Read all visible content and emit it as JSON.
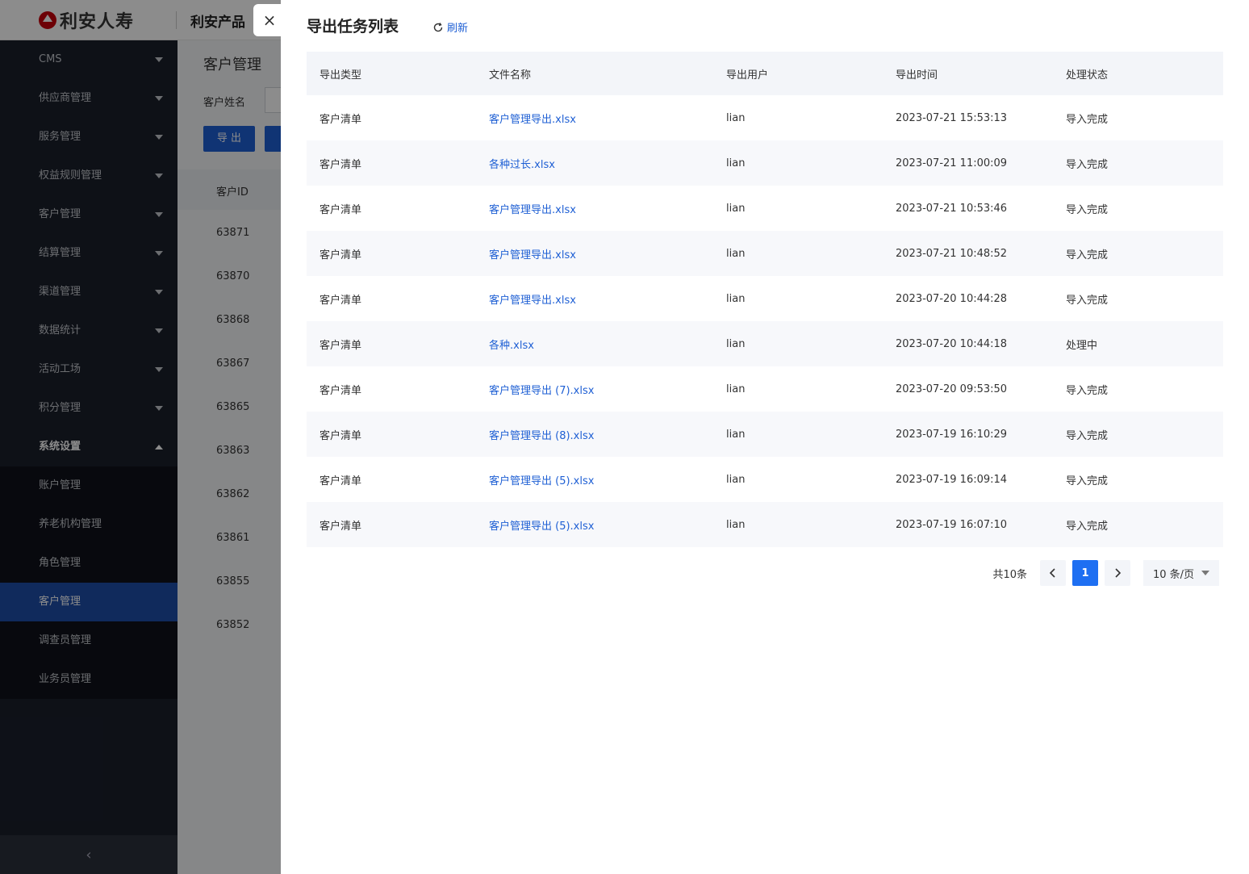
{
  "app": {
    "brand": "利安人寿",
    "product": "利安产品"
  },
  "sidebar": {
    "items": [
      {
        "label": "CMS"
      },
      {
        "label": "供应商管理"
      },
      {
        "label": "服务管理"
      },
      {
        "label": "权益规则管理"
      },
      {
        "label": "客户管理"
      },
      {
        "label": "结算管理"
      },
      {
        "label": "渠道管理"
      },
      {
        "label": "数据统计"
      },
      {
        "label": "活动工场"
      },
      {
        "label": "积分管理"
      },
      {
        "label": "系统设置"
      }
    ],
    "subitems": [
      {
        "label": "账户管理"
      },
      {
        "label": "养老机构管理"
      },
      {
        "label": "角色管理"
      },
      {
        "label": "客户管理"
      },
      {
        "label": "调查员管理"
      },
      {
        "label": "业务员管理"
      }
    ],
    "collapse": "‹"
  },
  "background_page": {
    "title": "客户管理",
    "filter_label": "客户姓名",
    "export_button": "导 出",
    "id_column": "客户ID",
    "ids": [
      "63871",
      "63870",
      "63868",
      "63867",
      "63865",
      "63863",
      "63862",
      "63861",
      "63855",
      "63852"
    ]
  },
  "drawer": {
    "close": "×",
    "title": "导出任务列表",
    "refresh_label": "刷新",
    "columns": [
      "导出类型",
      "文件名称",
      "导出用户",
      "导出时间",
      "处理状态"
    ],
    "rows": [
      {
        "type": "客户清单",
        "file": "客户管理导出.xlsx",
        "user": "lian",
        "time": "2023-07-21 15:53:13",
        "status": "导入完成"
      },
      {
        "type": "客户清单",
        "file": "各种过长.xlsx",
        "user": "lian",
        "time": "2023-07-21 11:00:09",
        "status": "导入完成"
      },
      {
        "type": "客户清单",
        "file": "客户管理导出.xlsx",
        "user": "lian",
        "time": "2023-07-21 10:53:46",
        "status": "导入完成"
      },
      {
        "type": "客户清单",
        "file": "客户管理导出.xlsx",
        "user": "lian",
        "time": "2023-07-21 10:48:52",
        "status": "导入完成"
      },
      {
        "type": "客户清单",
        "file": "客户管理导出.xlsx",
        "user": "lian",
        "time": "2023-07-20 10:44:28",
        "status": "导入完成"
      },
      {
        "type": "客户清单",
        "file": "各种.xlsx",
        "user": "lian",
        "time": "2023-07-20 10:44:18",
        "status": "处理中"
      },
      {
        "type": "客户清单",
        "file": "客户管理导出 (7).xlsx",
        "user": "lian",
        "time": "2023-07-20 09:53:50",
        "status": "导入完成"
      },
      {
        "type": "客户清单",
        "file": "客户管理导出 (8).xlsx",
        "user": "lian",
        "time": "2023-07-19 16:10:29",
        "status": "导入完成"
      },
      {
        "type": "客户清单",
        "file": "客户管理导出 (5).xlsx",
        "user": "lian",
        "time": "2023-07-19 16:09:14",
        "status": "导入完成"
      },
      {
        "type": "客户清单",
        "file": "客户管理导出 (5).xlsx",
        "user": "lian",
        "time": "2023-07-19 16:07:10",
        "status": "导入完成"
      }
    ],
    "pagination": {
      "total": "共10条",
      "current_page": "1",
      "page_size": "10 条/页"
    }
  },
  "colors": {
    "accent": "#1e5fd4",
    "sidebar_bg": "#1a1f2b",
    "sidebar_active": "#1e4ea8"
  }
}
